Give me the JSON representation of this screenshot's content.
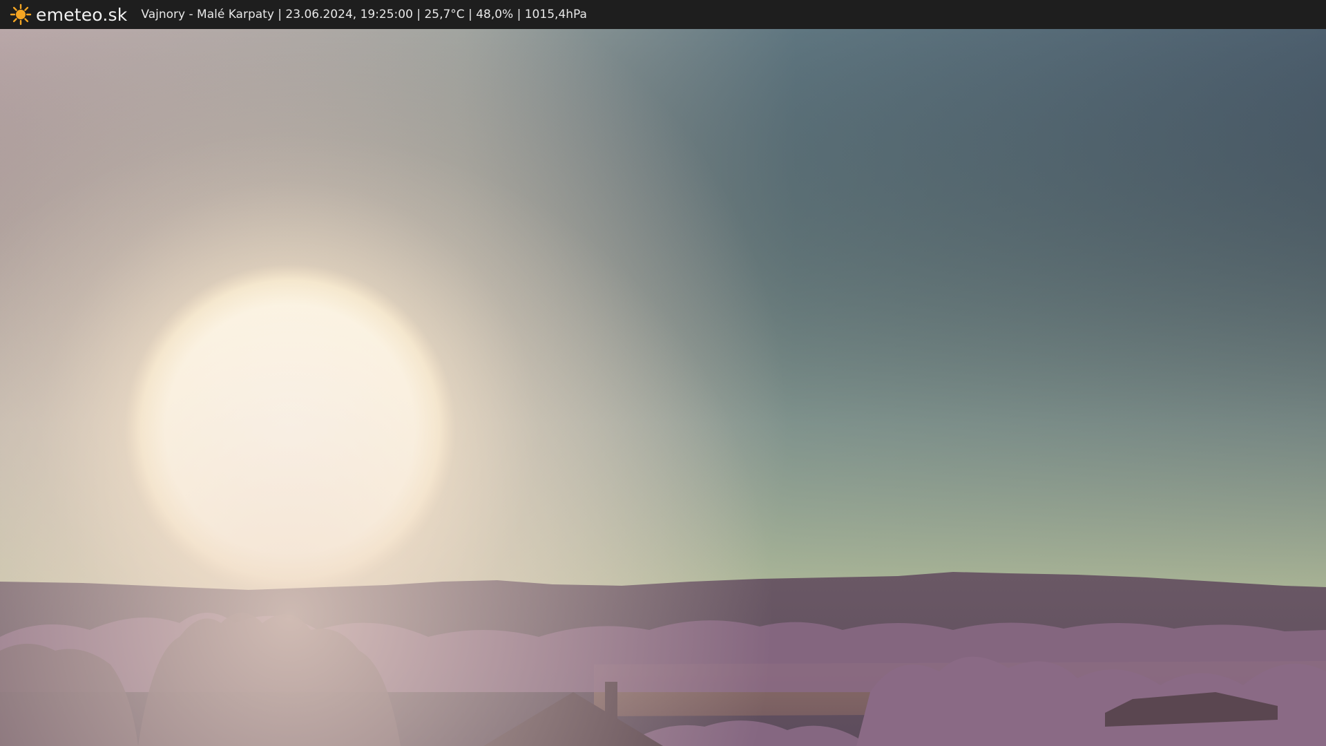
{
  "header": {
    "brand": "emeteo.sk",
    "caption": "Vajnory - Malé Karpaty | 23.06.2024, 19:25:00 | 25,7°C | 48,0% | 1015,4hPa",
    "logo_icon": "sun-icon",
    "background_color": "#1e1e1e",
    "logo_color": "#f5a623"
  },
  "scene": {
    "sky_top_right": "#4f6270",
    "sky_horizon": "#a9b79a",
    "sun_color": "#fffdf0",
    "hills_color": "#6e5a6a",
    "foliage_color": "#8c6a84"
  }
}
